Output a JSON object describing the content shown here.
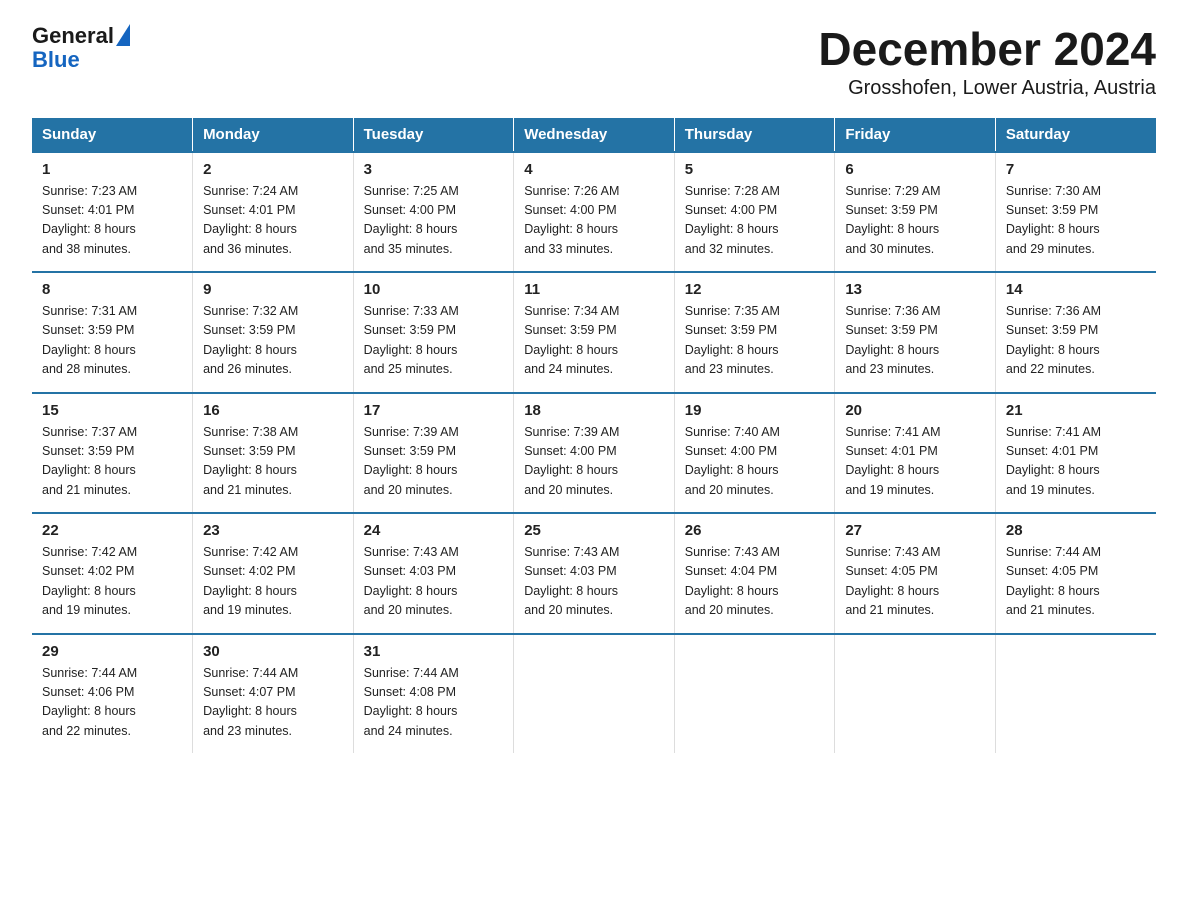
{
  "logo": {
    "general": "General",
    "blue": "Blue"
  },
  "title": "December 2024",
  "subtitle": "Grosshofen, Lower Austria, Austria",
  "days_of_week": [
    "Sunday",
    "Monday",
    "Tuesday",
    "Wednesday",
    "Thursday",
    "Friday",
    "Saturday"
  ],
  "weeks": [
    [
      {
        "num": "1",
        "sunrise": "7:23 AM",
        "sunset": "4:01 PM",
        "daylight": "8 hours and 38 minutes."
      },
      {
        "num": "2",
        "sunrise": "7:24 AM",
        "sunset": "4:01 PM",
        "daylight": "8 hours and 36 minutes."
      },
      {
        "num": "3",
        "sunrise": "7:25 AM",
        "sunset": "4:00 PM",
        "daylight": "8 hours and 35 minutes."
      },
      {
        "num": "4",
        "sunrise": "7:26 AM",
        "sunset": "4:00 PM",
        "daylight": "8 hours and 33 minutes."
      },
      {
        "num": "5",
        "sunrise": "7:28 AM",
        "sunset": "4:00 PM",
        "daylight": "8 hours and 32 minutes."
      },
      {
        "num": "6",
        "sunrise": "7:29 AM",
        "sunset": "3:59 PM",
        "daylight": "8 hours and 30 minutes."
      },
      {
        "num": "7",
        "sunrise": "7:30 AM",
        "sunset": "3:59 PM",
        "daylight": "8 hours and 29 minutes."
      }
    ],
    [
      {
        "num": "8",
        "sunrise": "7:31 AM",
        "sunset": "3:59 PM",
        "daylight": "8 hours and 28 minutes."
      },
      {
        "num": "9",
        "sunrise": "7:32 AM",
        "sunset": "3:59 PM",
        "daylight": "8 hours and 26 minutes."
      },
      {
        "num": "10",
        "sunrise": "7:33 AM",
        "sunset": "3:59 PM",
        "daylight": "8 hours and 25 minutes."
      },
      {
        "num": "11",
        "sunrise": "7:34 AM",
        "sunset": "3:59 PM",
        "daylight": "8 hours and 24 minutes."
      },
      {
        "num": "12",
        "sunrise": "7:35 AM",
        "sunset": "3:59 PM",
        "daylight": "8 hours and 23 minutes."
      },
      {
        "num": "13",
        "sunrise": "7:36 AM",
        "sunset": "3:59 PM",
        "daylight": "8 hours and 23 minutes."
      },
      {
        "num": "14",
        "sunrise": "7:36 AM",
        "sunset": "3:59 PM",
        "daylight": "8 hours and 22 minutes."
      }
    ],
    [
      {
        "num": "15",
        "sunrise": "7:37 AM",
        "sunset": "3:59 PM",
        "daylight": "8 hours and 21 minutes."
      },
      {
        "num": "16",
        "sunrise": "7:38 AM",
        "sunset": "3:59 PM",
        "daylight": "8 hours and 21 minutes."
      },
      {
        "num": "17",
        "sunrise": "7:39 AM",
        "sunset": "3:59 PM",
        "daylight": "8 hours and 20 minutes."
      },
      {
        "num": "18",
        "sunrise": "7:39 AM",
        "sunset": "4:00 PM",
        "daylight": "8 hours and 20 minutes."
      },
      {
        "num": "19",
        "sunrise": "7:40 AM",
        "sunset": "4:00 PM",
        "daylight": "8 hours and 20 minutes."
      },
      {
        "num": "20",
        "sunrise": "7:41 AM",
        "sunset": "4:01 PM",
        "daylight": "8 hours and 19 minutes."
      },
      {
        "num": "21",
        "sunrise": "7:41 AM",
        "sunset": "4:01 PM",
        "daylight": "8 hours and 19 minutes."
      }
    ],
    [
      {
        "num": "22",
        "sunrise": "7:42 AM",
        "sunset": "4:02 PM",
        "daylight": "8 hours and 19 minutes."
      },
      {
        "num": "23",
        "sunrise": "7:42 AM",
        "sunset": "4:02 PM",
        "daylight": "8 hours and 19 minutes."
      },
      {
        "num": "24",
        "sunrise": "7:43 AM",
        "sunset": "4:03 PM",
        "daylight": "8 hours and 20 minutes."
      },
      {
        "num": "25",
        "sunrise": "7:43 AM",
        "sunset": "4:03 PM",
        "daylight": "8 hours and 20 minutes."
      },
      {
        "num": "26",
        "sunrise": "7:43 AM",
        "sunset": "4:04 PM",
        "daylight": "8 hours and 20 minutes."
      },
      {
        "num": "27",
        "sunrise": "7:43 AM",
        "sunset": "4:05 PM",
        "daylight": "8 hours and 21 minutes."
      },
      {
        "num": "28",
        "sunrise": "7:44 AM",
        "sunset": "4:05 PM",
        "daylight": "8 hours and 21 minutes."
      }
    ],
    [
      {
        "num": "29",
        "sunrise": "7:44 AM",
        "sunset": "4:06 PM",
        "daylight": "8 hours and 22 minutes."
      },
      {
        "num": "30",
        "sunrise": "7:44 AM",
        "sunset": "4:07 PM",
        "daylight": "8 hours and 23 minutes."
      },
      {
        "num": "31",
        "sunrise": "7:44 AM",
        "sunset": "4:08 PM",
        "daylight": "8 hours and 24 minutes."
      },
      null,
      null,
      null,
      null
    ]
  ],
  "labels": {
    "sunrise": "Sunrise:",
    "sunset": "Sunset:",
    "daylight": "Daylight:"
  }
}
